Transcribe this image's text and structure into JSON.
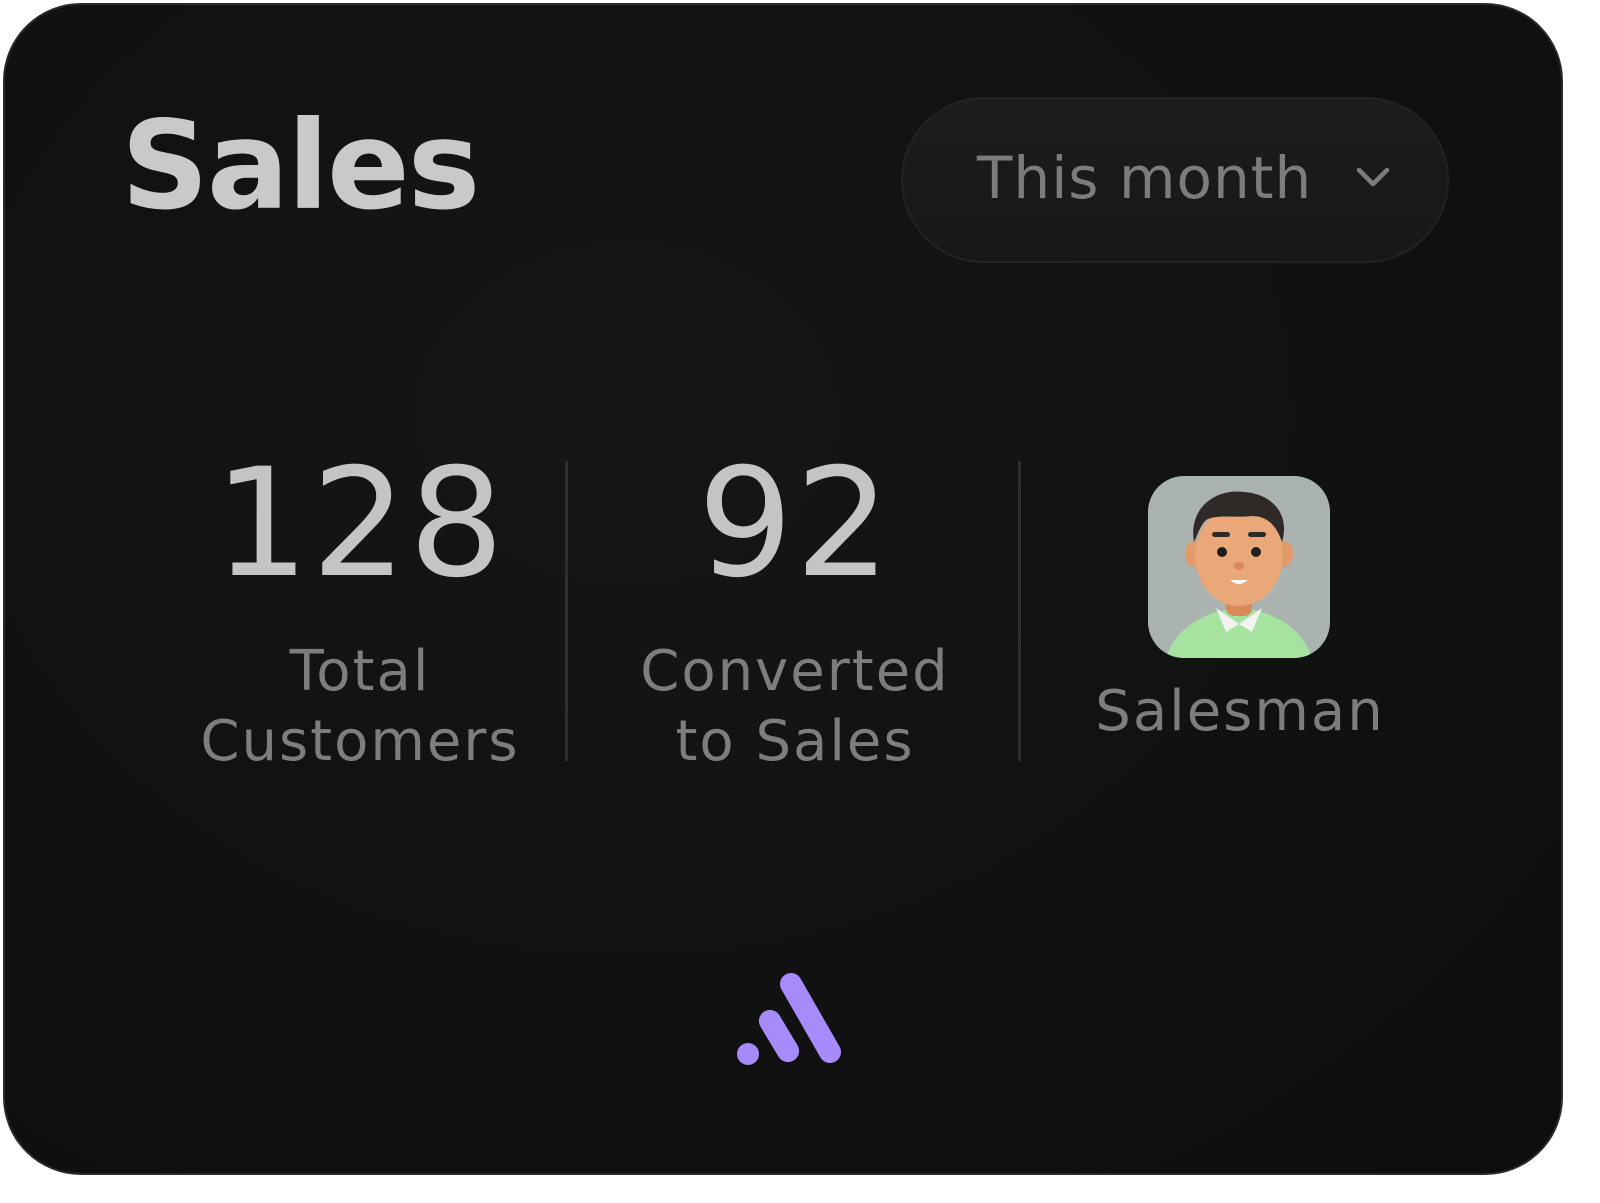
{
  "card": {
    "title": "Sales",
    "period_selector": {
      "value": "This month",
      "icon": "chevron-down-icon"
    }
  },
  "stats": [
    {
      "value": "128",
      "label_line1": "Total",
      "label_line2": "Customers"
    },
    {
      "value": "92",
      "label_line1": "Converted",
      "label_line2": "to Sales"
    }
  ],
  "salesman": {
    "label": "Salesman",
    "avatar_icon": "salesman-avatar"
  },
  "brand": {
    "logo_icon": "brand-logo-icon",
    "accent_color": "#a78bfa"
  },
  "colors": {
    "background": "#111111",
    "title": "#c9c9c9",
    "muted_text": "#7d7d7d",
    "avatar_bg": "#aab3b0"
  }
}
